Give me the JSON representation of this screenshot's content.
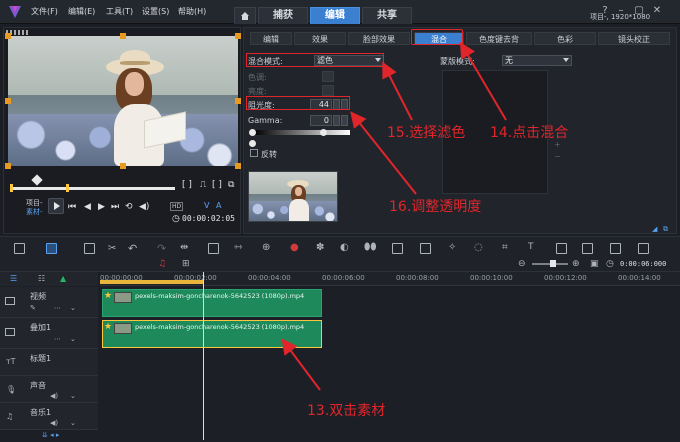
{
  "window": {
    "status": "项目-, 1920*1080",
    "menu": [
      "文件(F)",
      "编辑(E)",
      "工具(T)",
      "设置(S)",
      "帮助(H)"
    ],
    "workspace_tabs": [
      {
        "label": "捕获",
        "active": false
      },
      {
        "label": "编辑",
        "active": true
      },
      {
        "label": "共享",
        "active": false
      }
    ],
    "home_icon": "home-icon"
  },
  "preview": {
    "mode_labels": [
      "项目-",
      "素材-"
    ],
    "timecode": "00:00:02:05",
    "hd_badge": "HD",
    "v_label": "V",
    "a_label": "A"
  },
  "options": {
    "tabs": [
      {
        "label": "编辑",
        "active": false
      },
      {
        "label": "效果",
        "active": false
      },
      {
        "label": "脸部效果",
        "active": false
      },
      {
        "label": "混合",
        "active": true
      },
      {
        "label": "色度键去背",
        "active": false
      },
      {
        "label": "色彩",
        "active": false
      },
      {
        "label": "镜头校正",
        "active": false
      }
    ],
    "blend_mode_label": "混合模式:",
    "blend_mode_value": "滤色",
    "mask_mode_label": "蒙版模式:",
    "mask_mode_value": "无",
    "hue_label": "色调:",
    "highlight_label": "亮度:",
    "opacity_label": "阻光度:",
    "opacity_value": "44",
    "gamma_label": "Gamma:",
    "gamma_value": "0",
    "invert_label": "反转"
  },
  "annotations": {
    "step13": "13.双击素材",
    "step14": "14.点击混合",
    "step15": "15.选择滤色",
    "step16": "16.调整透明度"
  },
  "timeline": {
    "zoom_timecode": "0:00:06:000",
    "ruler": [
      "00:00:00:00",
      "00:00:02:00",
      "00:00:04:00",
      "00:00:06:00",
      "00:00:08:00",
      "00:00:10:00",
      "00:00:12:00",
      "00:00:14:00"
    ],
    "tracks": [
      {
        "name": "视频"
      },
      {
        "name": "叠加1"
      },
      {
        "name": "标题1"
      },
      {
        "name": "声音"
      },
      {
        "name": "音乐1"
      }
    ],
    "clips": [
      {
        "label": "pexels-maksim-goncharenok-5642523 (1080p).mp4",
        "track": "视频"
      },
      {
        "label": "pexels-maksim-goncharenok-5642523 (1080p).mp4",
        "track": "叠加1"
      }
    ]
  },
  "colors": {
    "accent": "#3b7fd0",
    "annotation": "#e0262b",
    "clip": "#1e8a5c",
    "handle": "#e89a20"
  }
}
